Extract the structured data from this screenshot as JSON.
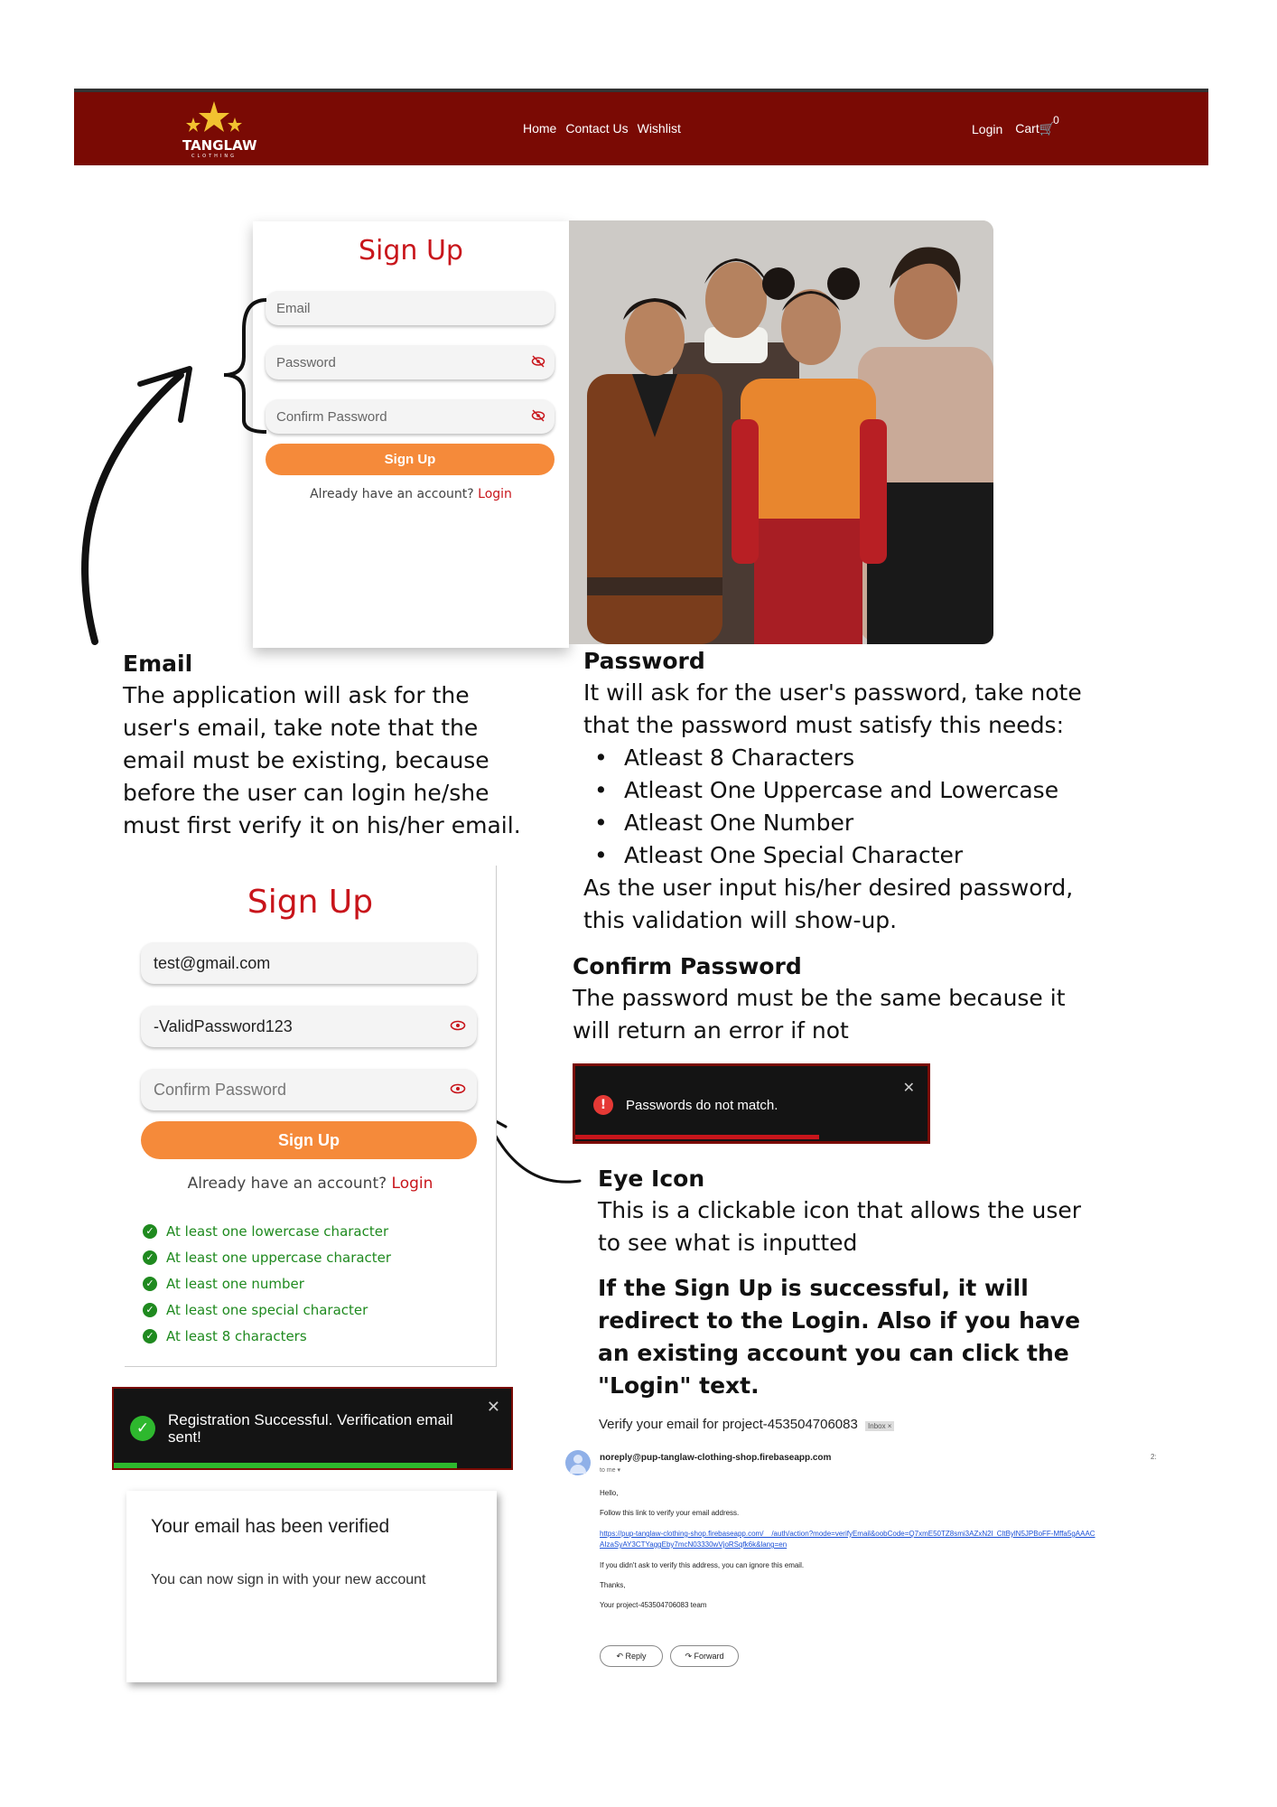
{
  "nav": {
    "logo_text": "TANGLAW",
    "logo_sub": "CLOTHING",
    "links": [
      "Home",
      "Contact Us",
      "Wishlist"
    ],
    "login": "Login",
    "cart": "Cart",
    "cart_count": "0"
  },
  "signup1": {
    "title": "Sign Up",
    "email_placeholder": "Email",
    "password_placeholder": "Password",
    "confirm_placeholder": "Confirm Password",
    "button": "Sign Up",
    "already": "Already have an account?",
    "login_link": "Login"
  },
  "annotations": {
    "email_heading": "Email",
    "email_text": "The application will ask for the user's email, take note that the email must be existing, because before the user can login he/she must first verify it on his/her email.",
    "password_heading": "Password",
    "password_text": "It will ask for the user's password, take note that the password must satisfy this needs:",
    "password_rules": [
      "Atleast 8 Characters",
      "Atleast One Uppercase and Lowercase",
      "Atleast One Number",
      "Atleast One Special Character"
    ],
    "password_after": "As the user input his/her desired password, this validation will show-up.",
    "confirm_heading": "Confirm Password",
    "confirm_text": "The password must be the same because it will return an error if not",
    "eye_heading": "Eye Icon",
    "eye_text": "This is a clickable icon that allows the user to see what is inputted",
    "success_text": "If the Sign Up is successful, it will redirect to the Login. Also if you have an existing account you can click the \"Login\" text."
  },
  "signup2": {
    "title": "Sign Up",
    "email_value": "test@gmail.com",
    "password_value": "-ValidPassword123",
    "confirm_placeholder": "Confirm Password",
    "button": "Sign Up",
    "already": "Already have an account?",
    "login_link": "Login",
    "checks": [
      "At least one lowercase character",
      "At least one uppercase character",
      "At least one number",
      "At least one special character",
      "At least 8 characters"
    ]
  },
  "toast_error": {
    "text": "Passwords do not match.",
    "close": "✕"
  },
  "toast_success": {
    "text": "Registration Successful. Verification email sent!",
    "close": "✕"
  },
  "verified": {
    "title": "Your email has been verified",
    "text": "You can now sign in with your new account"
  },
  "email": {
    "subject": "Verify your email for project-453504706083",
    "badge": "Inbox ×",
    "sender": "noreply@pup-tanglaw-clothing-shop.firebaseapp.com",
    "to": "to me ▾",
    "time": "2:",
    "hello": "Hello,",
    "follow": "Follow this link to verify your email address.",
    "link1": "https://pup-tanglaw-clothing-shop.firebaseapp.com/__/auth/action?mode=verifyEmail&oobCode=Q7xmE50TZ8smi3AZxN2l_CltBylN5JPBoFF-Mffa5gAAAC",
    "link2": "AIzaSyAY3CTYaggEby7mcN03330wVjoRSqfk6k&lang=en",
    "ignore": "If you didn't ask to verify this address, you can ignore this email.",
    "thanks": "Thanks,",
    "team": "Your project-453504706083 team",
    "reply": "Reply",
    "forward": "Forward"
  },
  "colors": {
    "nav_bg": "#7a0a04",
    "accent_red": "#c8151b",
    "button_orange": "#f58a3a",
    "success_green": "#1f8a1f"
  }
}
